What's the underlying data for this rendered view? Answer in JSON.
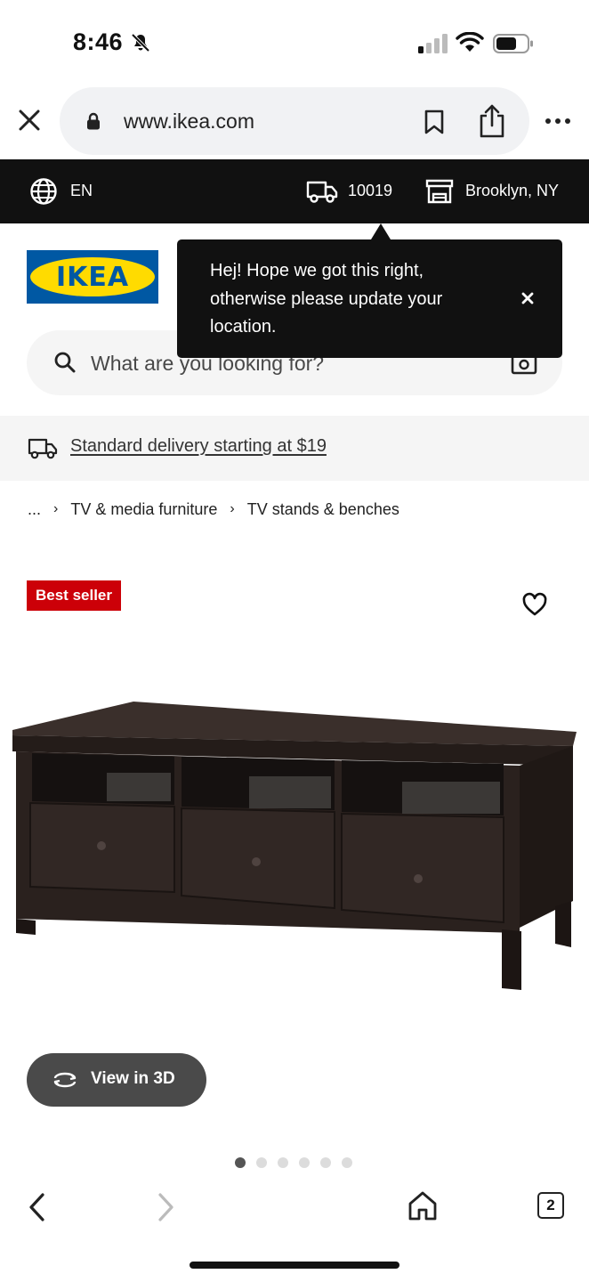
{
  "status_bar": {
    "time": "8:46"
  },
  "browser": {
    "url": "www.ikea.com",
    "tab_count": "2"
  },
  "top_bar": {
    "language": "EN",
    "zip": "10019",
    "store": "Brooklyn, NY"
  },
  "logo": {
    "text": "IKEA"
  },
  "search": {
    "placeholder": "What are you looking for?"
  },
  "tooltip": {
    "message": "Hej! Hope we got this right, otherwise please update your location."
  },
  "delivery": {
    "text": "Standard delivery starting at $19"
  },
  "breadcrumb": {
    "ellipsis": "...",
    "items": [
      "TV & media furniture",
      "TV stands & benches"
    ]
  },
  "product": {
    "badge": "Best seller",
    "view_3d_label": "View in 3D",
    "image_count": 6,
    "active_image": 1
  },
  "colors": {
    "badge": "#cc0008",
    "ikea_blue": "#0058a3",
    "ikea_yellow": "#ffdb00",
    "top_bar": "#111111"
  }
}
